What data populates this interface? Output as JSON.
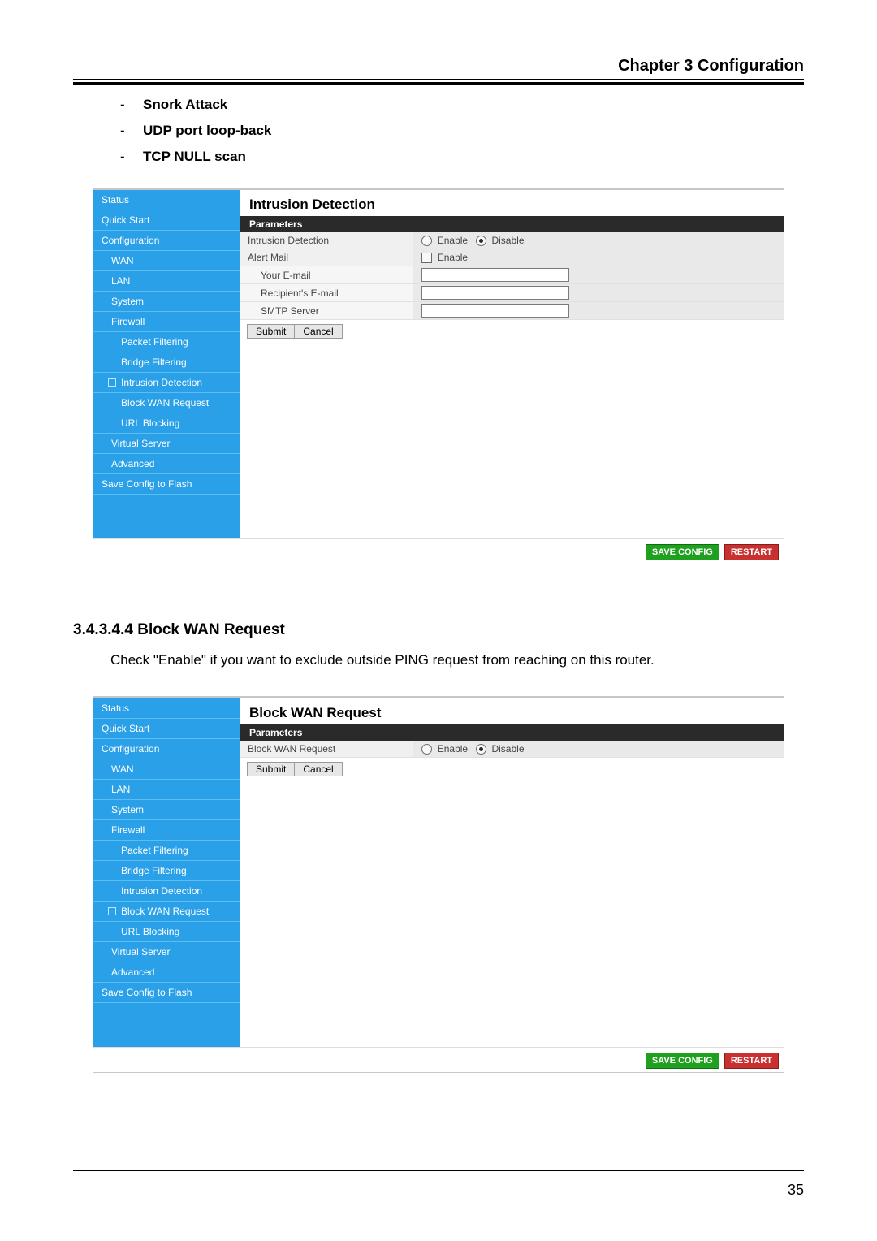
{
  "chapter_header": "Chapter 3 Configuration",
  "bullets": [
    "Snork Attack",
    "UDP port loop-back",
    "TCP NULL scan"
  ],
  "section": {
    "number_heading": "3.4.3.4.4 Block WAN Request",
    "text": "Check \"Enable\" if you want to exclude outside PING request from reaching on this router."
  },
  "page_number": "35",
  "nav": {
    "status": "Status",
    "quick_start": "Quick Start",
    "configuration": "Configuration",
    "wan": "WAN",
    "lan": "LAN",
    "system": "System",
    "firewall": "Firewall",
    "packet_filtering": "Packet Filtering",
    "bridge_filtering": "Bridge Filtering",
    "intrusion_detection": "Intrusion Detection",
    "block_wan_request": "Block WAN Request",
    "url_blocking": "URL Blocking",
    "virtual_server": "Virtual Server",
    "advanced": "Advanced",
    "save_config": "Save Config to Flash"
  },
  "common": {
    "parameters": "Parameters",
    "enable": "Enable",
    "disable": "Disable",
    "submit": "Submit",
    "cancel": "Cancel",
    "save_config_btn": "SAVE CONFIG",
    "restart_btn": "RESTART"
  },
  "panel1": {
    "title": "Intrusion Detection",
    "rows": {
      "intrusion_detection": "Intrusion Detection",
      "alert_mail": "Alert Mail",
      "your_email": "Your E-mail",
      "recipient_email": "Recipient's E-mail",
      "smtp_server": "SMTP Server"
    },
    "values": {
      "intrusion_detection_selected": "disable",
      "alert_mail_checked": false,
      "your_email": "",
      "recipient_email": "",
      "smtp_server": ""
    }
  },
  "panel2": {
    "title": "Block WAN Request",
    "rows": {
      "block_wan_request": "Block WAN Request"
    },
    "values": {
      "block_wan_request_selected": "disable"
    }
  }
}
